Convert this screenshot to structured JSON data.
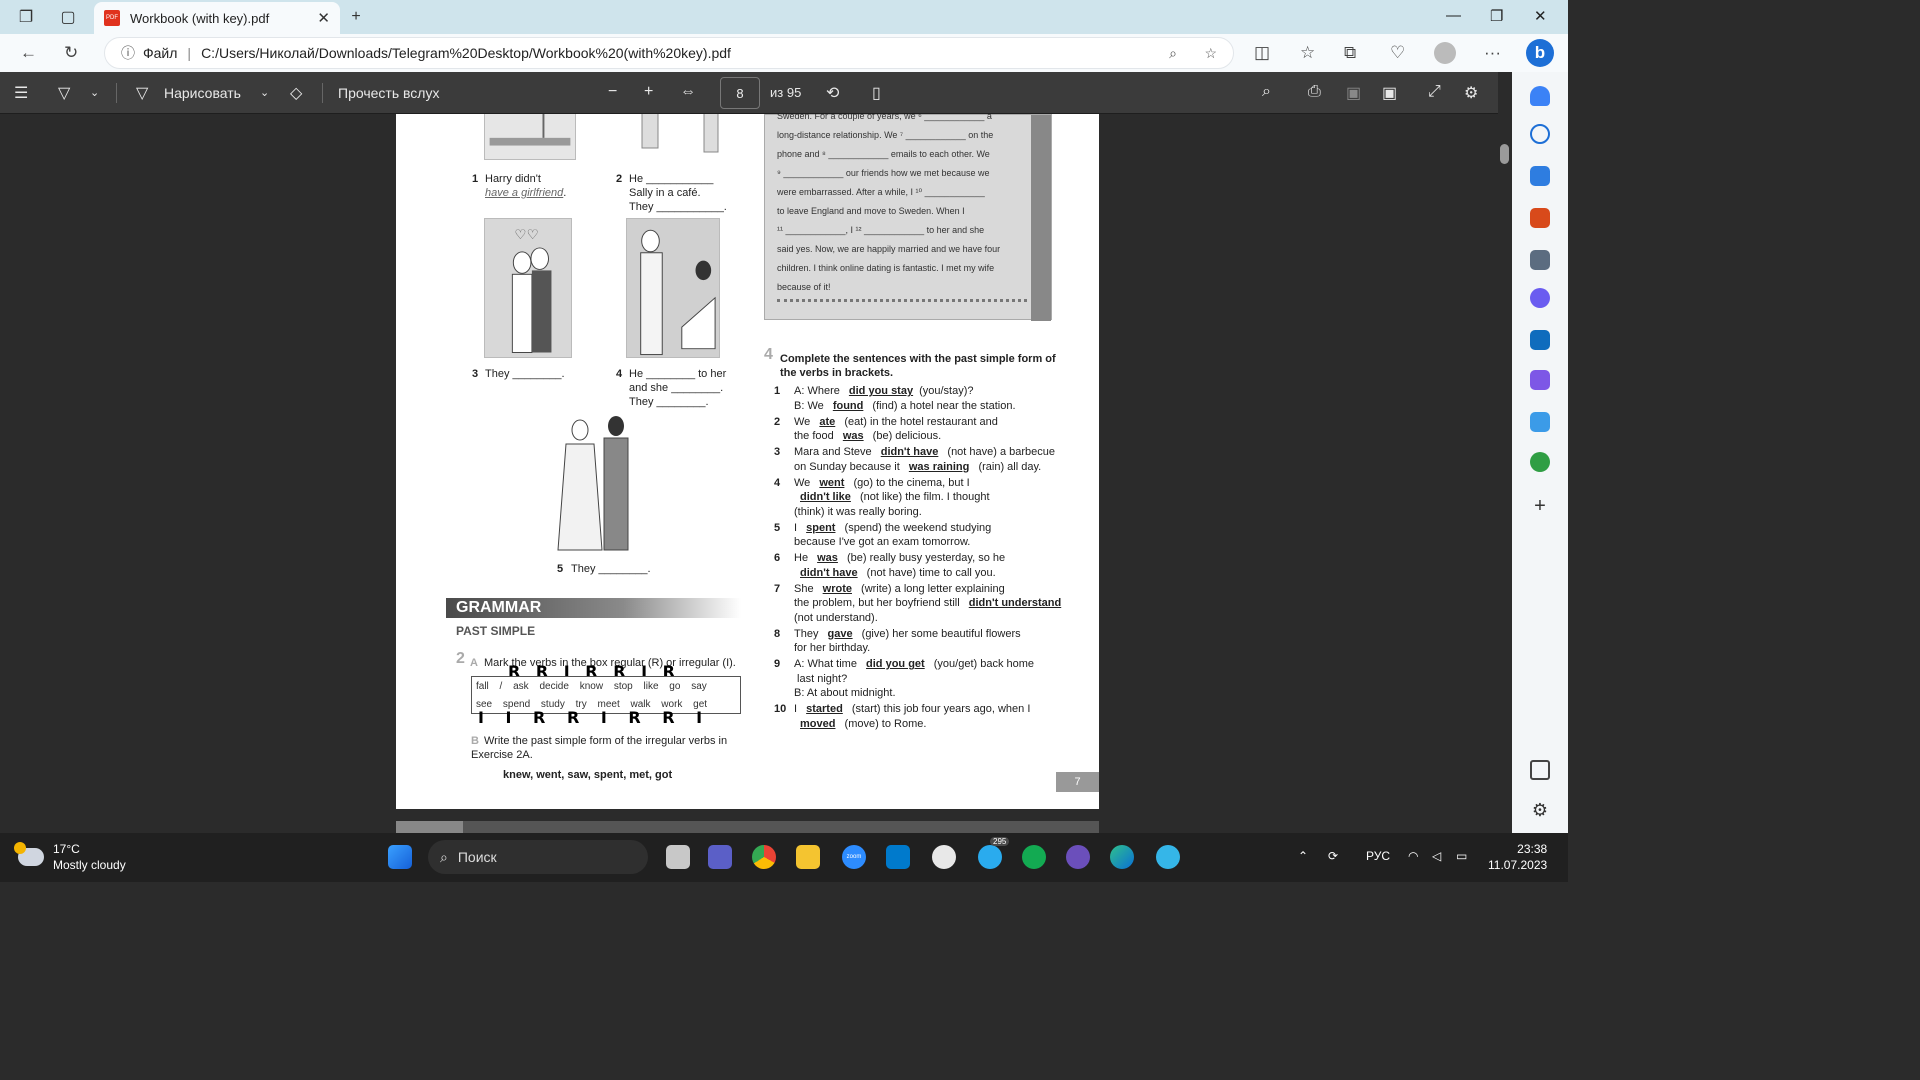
{
  "browser": {
    "tab_title": "Workbook (with key).pdf",
    "pdf_label": "PDF",
    "address_prefix": "Файл",
    "address_url": "C:/Users/Николай/Downloads/Telegram%20Desktop/Workbook%20(with%20key).pdf"
  },
  "pdf_toolbar": {
    "draw_label": "Нарисовать",
    "read_aloud_label": "Прочесть вслух",
    "page_number": "8",
    "page_total": "из 95"
  },
  "page": {
    "ex1": {
      "items": [
        {
          "n": "1",
          "text": "Harry didn't",
          "answer": "have a girlfriend",
          "tail": "."
        },
        {
          "n": "2",
          "line1": "He ___________",
          "line2": "Sally in a café.",
          "line3": "They ___________."
        },
        {
          "n": "3",
          "text": "They ________."
        },
        {
          "n": "4",
          "line1": "He ________ to her",
          "line2": "and she ________.",
          "line3": "They ________."
        },
        {
          "n": "5",
          "text": "They ________."
        }
      ]
    },
    "story": {
      "lines": [
        "Sweden. For a couple of years, we ⁶ ____________ a",
        "long-distance relationship. We ⁷ ____________ on the",
        "phone and ⁸ ____________ emails to each other. We",
        "⁹ ____________ our friends how we met because we",
        "were embarrassed. After a while, I ¹⁰ ____________",
        "to leave England and move to Sweden. When I",
        "¹¹ ____________, I ¹² ____________ to her and she",
        "said yes. Now, we are happily married and we have four",
        "children. I think online dating is fantastic. I met my wife",
        "because of it!"
      ]
    },
    "grammar": {
      "band": "GRAMMAR",
      "subtitle": "PAST SIMPLE",
      "ex2a_num": "2",
      "ex2a_letter": "A",
      "ex2a_instruction": "Mark the verbs in the box regular (R) or irregular (I).",
      "verbs_row1": "fall / ask decide know stop like go say",
      "verbs_row2": "see spend study try meet walk work get",
      "marks_row1": "R R I R R I R",
      "marks_row2": "I I R R I R R I",
      "ex2b_letter": "B",
      "ex2b_instruction_1": "Write the past simple form of the irregular verbs in",
      "ex2b_instruction_2": "Exercise 2A.",
      "ex2b_answer": "knew, went, saw, spent, met, got"
    },
    "ex4": {
      "num": "4",
      "instruction_1": "Complete the sentences with the past simple form of",
      "instruction_2": "the verbs in brackets.",
      "lines": [
        {
          "n": "1",
          "text": "A:  Where ",
          "ans": "did you stay",
          "rest": "(you/stay)?"
        },
        {
          "n": "",
          "text": "B:  We ",
          "ans": "found",
          "rest": " (find) a hotel near the station."
        },
        {
          "n": "2",
          "text": "We ",
          "ans": "ate",
          "rest": " (eat) in the hotel restaurant and"
        },
        {
          "n": "",
          "text": "the food ",
          "ans": "was",
          "rest": " (be) delicious."
        },
        {
          "n": "3",
          "text": "Mara and Steve ",
          "ans": "didn't have",
          "rest": " (not have) a barbecue"
        },
        {
          "n": "",
          "text": "on Sunday because it ",
          "ans": "was raining",
          "rest": " (rain) all day."
        },
        {
          "n": "4",
          "text": "We ",
          "ans": "went",
          "rest": " (go) to the cinema, but I"
        },
        {
          "n": "",
          "text": "",
          "ans": "didn't like",
          "rest": " (not like) the film. I  thought"
        },
        {
          "n": "",
          "text": "(think) it was really boring.",
          "ans": "",
          "rest": ""
        },
        {
          "n": "5",
          "text": "I ",
          "ans": "spent",
          "rest": " (spend) the weekend studying"
        },
        {
          "n": "",
          "text": "because I've got an exam tomorrow.",
          "ans": "",
          "rest": ""
        },
        {
          "n": "6",
          "text": "He ",
          "ans": "was",
          "rest": " (be) really busy yesterday, so he"
        },
        {
          "n": "",
          "text": "",
          "ans": "didn't have",
          "rest": " (not have) time to call you."
        },
        {
          "n": "7",
          "text": "She ",
          "ans": "wrote",
          "rest": " (write) a long letter explaining"
        },
        {
          "n": "",
          "text": "the problem, but her boyfriend still ",
          "ans": "didn't understand",
          "rest": ""
        },
        {
          "n": "",
          "text": "(not understand).",
          "ans": "",
          "rest": ""
        },
        {
          "n": "8",
          "text": "They ",
          "ans": "gave",
          "rest": " (give) her some beautiful flowers"
        },
        {
          "n": "",
          "text": "for her birthday.",
          "ans": "",
          "rest": ""
        },
        {
          "n": "9",
          "text": "A:  What time ",
          "ans": "did you get",
          "rest": " (you/get) back home"
        },
        {
          "n": "",
          "text": "      last night?",
          "ans": "",
          "rest": ""
        },
        {
          "n": "",
          "text": "B:  At about midnight.",
          "ans": "",
          "rest": ""
        },
        {
          "n": "10",
          "text": "I ",
          "ans": "started",
          "rest": " (start) this job four years ago, when I"
        },
        {
          "n": "",
          "text": "",
          "ans": "moved",
          "rest": " (move) to Rome."
        }
      ]
    },
    "page_number_footer": "7"
  },
  "taskbar": {
    "temperature": "17°C",
    "weather": "Mostly cloudy",
    "search_label": "Поиск",
    "telegram_badge": "295",
    "zoom_label": "zoom",
    "language": "РУС",
    "time": "23:38",
    "date": "11.07.2023"
  },
  "icons": {
    "tabs": "tab-actions-icon",
    "vertical_tabs": "vertical-tabs-icon",
    "new_tab": "plus-icon",
    "back": "back-arrow-icon",
    "refresh": "refresh-icon",
    "info": "info-icon",
    "zoom": "zoom-icon",
    "favorite": "star-icon"
  }
}
